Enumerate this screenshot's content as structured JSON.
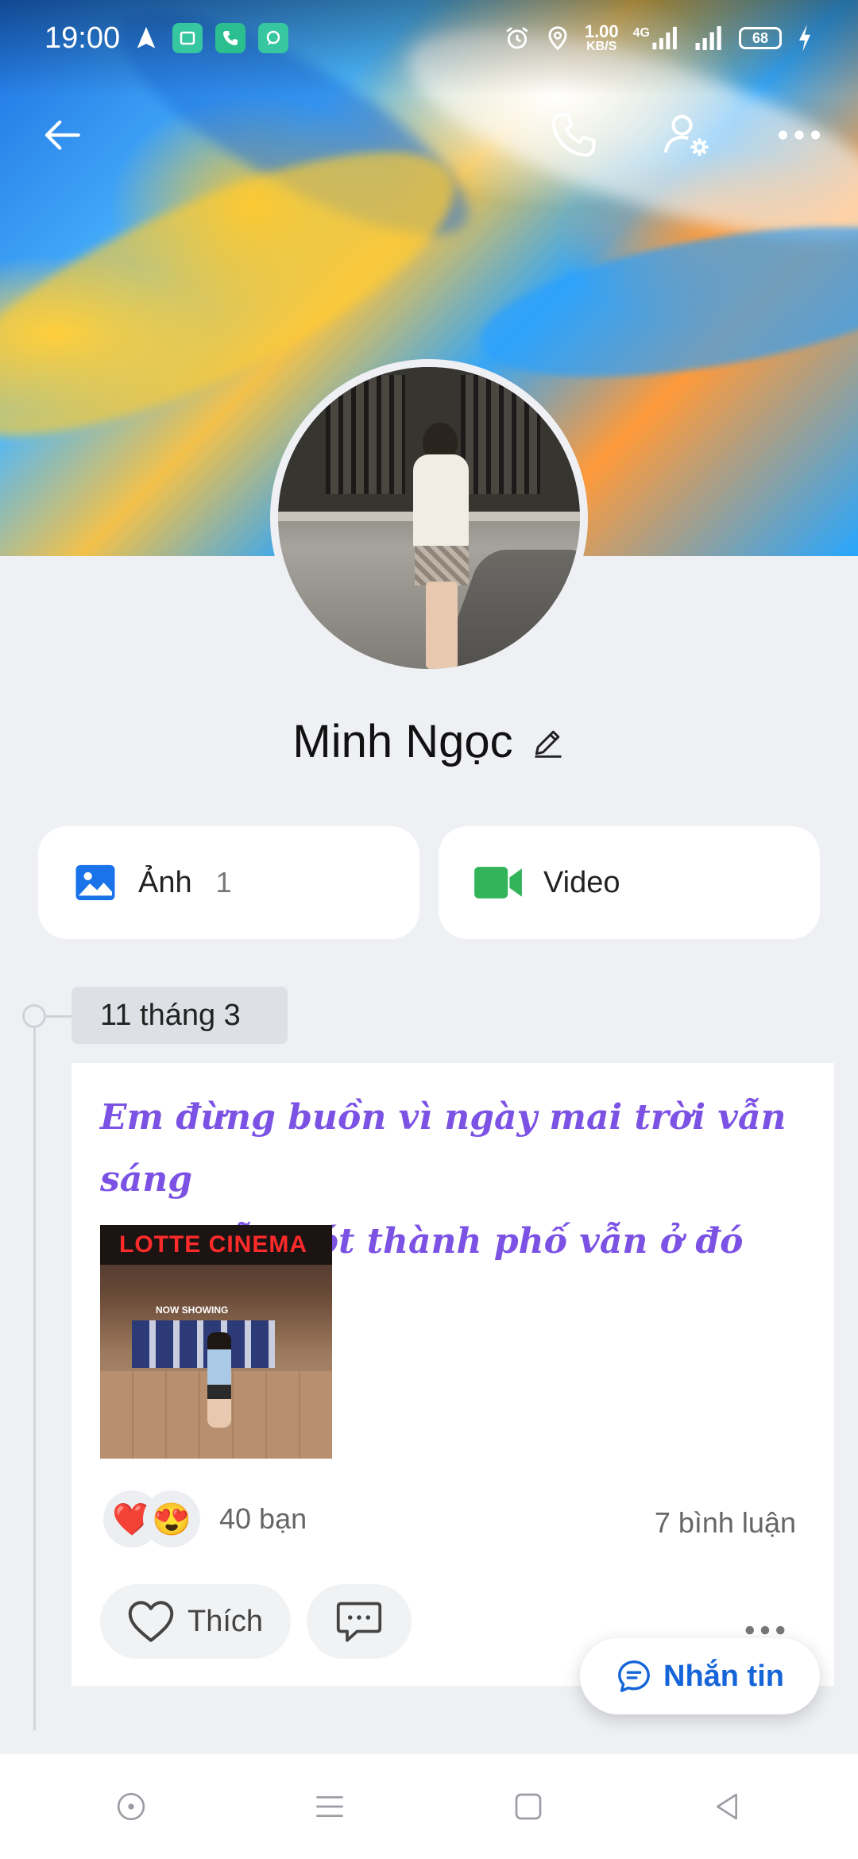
{
  "status_bar": {
    "time": "19:00",
    "net_speed_value": "1.00",
    "net_speed_unit": "KB/S",
    "network_type": "4G",
    "battery": "68",
    "icons": [
      "navigation-arrow-icon",
      "app-badge-icon",
      "phone-badge-icon",
      "message-badge-icon",
      "alarm-icon",
      "location-icon",
      "signal-icon",
      "wifi-signal-icon",
      "charging-icon"
    ]
  },
  "top_nav": {
    "icons": [
      "back-arrow-icon",
      "phone-call-icon",
      "profile-settings-icon",
      "more-options-icon"
    ]
  },
  "profile": {
    "name": "Minh Ngọc"
  },
  "media_tabs": [
    {
      "label": "Ảnh",
      "count": "1",
      "icon": "photo-icon",
      "color": "#1a73e8"
    },
    {
      "label": "Video",
      "count": "",
      "icon": "video-camera-icon",
      "color": "#34b45a"
    }
  ],
  "timeline": {
    "date": "11 tháng 3",
    "post": {
      "caption_line1": "Em đừng buồn vì ngày mai trời vẫn sáng",
      "caption_line2": "chim vẫn hót thành phố vẫn ở đó",
      "caption_color": "#7b52e4",
      "photo_sign": "LOTTE CINEMA",
      "photo_subtext": "NOW SHOWING",
      "reactions": [
        "❤️",
        "😍"
      ],
      "reaction_count": "40 bạn",
      "comment_count": "7 bình luận",
      "like_label": "Thích"
    }
  },
  "fab": {
    "label": "Nhắn tin",
    "color": "#1565d8"
  }
}
